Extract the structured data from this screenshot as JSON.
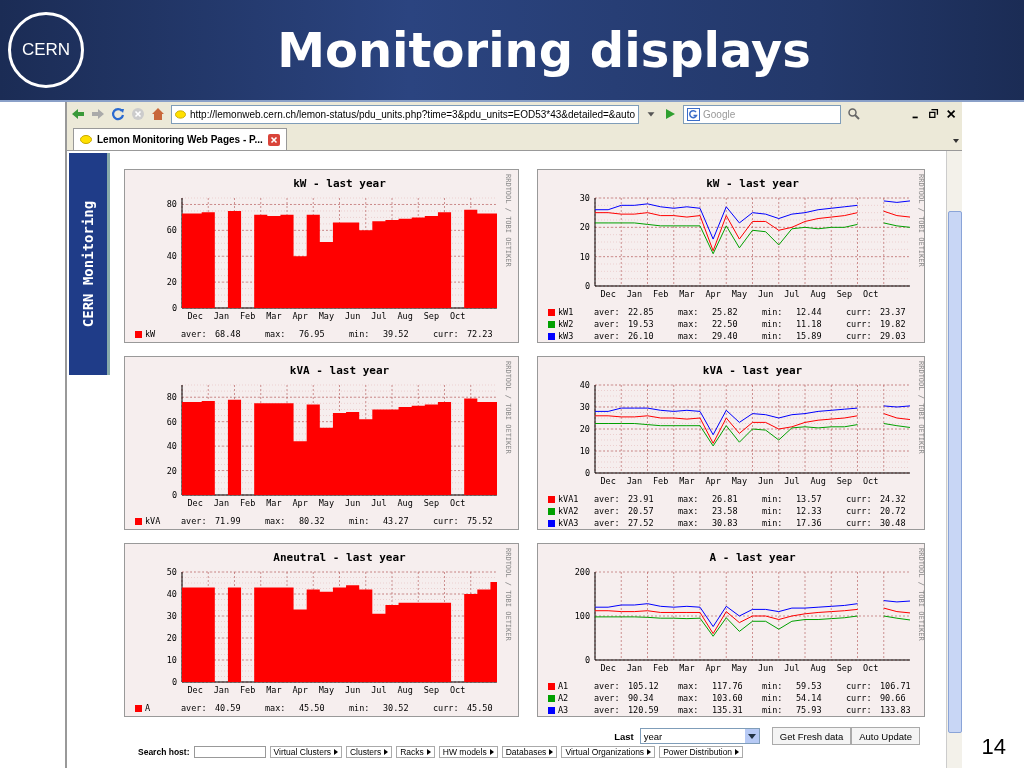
{
  "slide": {
    "logo": "CERN",
    "title": "Monitoring displays",
    "page_number": "14"
  },
  "browser": {
    "url": "http://lemonweb.cern.ch/lemon-status/pdu_units.php?time=3&pdu_units=EOD53*43&detailed=&auto",
    "search_placeholder": "Google",
    "tabs": [
      {
        "label": "Lemon Monitoring Web Pages - P...",
        "selected": true
      }
    ]
  },
  "sidebar_tab": {
    "label": "CERN Monitoring"
  },
  "charts": [
    {
      "credit": "RRDTOOL / TOBI OETIKER",
      "legend": [
        {
          "stats": [
            {
              "label": "aver:",
              "value": "68.48"
            },
            {
              "label": "max:",
              "value": "76.95"
            },
            {
              "label": "min:",
              "value": "39.52"
            },
            {
              "label": "curr:",
              "value": "72.23"
            }
          ]
        }
      ],
      "chart_data": {
        "grid": true,
        "type": "area",
        "title": "kW - last year",
        "categories": [
          null,
          "Dec",
          null,
          "Jan",
          null,
          "Feb",
          null,
          "Mar",
          null,
          "Apr",
          null,
          "May",
          null,
          "Jun",
          null,
          "Jul",
          null,
          "Aug",
          null,
          "Sep",
          null,
          "Oct",
          null,
          null,
          null
        ],
        "ylim": [
          0,
          85
        ],
        "yticks": [
          0,
          20,
          40,
          60,
          80
        ],
        "series": [
          {
            "name": "kW",
            "color": "#ff0000",
            "values": [
              73,
              73,
              74,
              null,
              75,
              null,
              72,
              71,
              72,
              40,
              72,
              51,
              66,
              66,
              60,
              67,
              68,
              69,
              70,
              71,
              74,
              null,
              76,
              73,
              73
            ]
          }
        ]
      }
    },
    {
      "credit": "RRDTOOL / TOBI OETIKER",
      "legend": [
        {
          "stats": [
            {
              "label": "aver:",
              "value": "22.85"
            },
            {
              "label": "max:",
              "value": "25.82"
            },
            {
              "label": "min:",
              "value": "12.44"
            },
            {
              "label": "curr:",
              "value": "23.37"
            }
          ]
        },
        {
          "stats": [
            {
              "label": "aver:",
              "value": "19.53"
            },
            {
              "label": "max:",
              "value": "22.50"
            },
            {
              "label": "min:",
              "value": "11.18"
            },
            {
              "label": "curr:",
              "value": "19.82"
            }
          ]
        },
        {
          "stats": [
            {
              "label": "aver:",
              "value": "26.10"
            },
            {
              "label": "max:",
              "value": "29.40"
            },
            {
              "label": "min:",
              "value": "15.89"
            },
            {
              "label": "curr:",
              "value": "29.03"
            }
          ]
        }
      ],
      "chart_data": {
        "grid": true,
        "type": "line",
        "title": "kW - last year",
        "categories": [
          null,
          "Dec",
          null,
          "Jan",
          null,
          "Feb",
          null,
          "Mar",
          null,
          "Apr",
          null,
          "May",
          null,
          "Jun",
          null,
          "Jul",
          null,
          "Aug",
          null,
          "Sep",
          null,
          "Oct",
          null,
          null,
          null
        ],
        "ylim": [
          0,
          30
        ],
        "yticks": [
          0,
          10,
          20,
          30
        ],
        "series": [
          {
            "name": "kW1",
            "color": "#ff0000",
            "values": [
              25,
              25,
              24.5,
              24.5,
              25,
              24,
              24,
              23.5,
              24,
              12,
              24,
              16,
              22,
              22,
              19,
              20,
              22,
              23,
              23.5,
              24,
              25,
              null,
              25.5,
              24,
              23.5
            ]
          },
          {
            "name": "kW2",
            "color": "#00a000",
            "values": [
              21.5,
              21.5,
              21.5,
              21.5,
              21,
              20.5,
              20.5,
              20.5,
              20.5,
              11,
              20.5,
              13,
              19,
              18.5,
              14,
              19.5,
              20,
              19.5,
              20,
              20,
              21,
              null,
              21.5,
              20.5,
              20
            ]
          },
          {
            "name": "kW3",
            "color": "#0000ff",
            "values": [
              26,
              26,
              27.5,
              27.5,
              28,
              27,
              26.5,
              27,
              26.5,
              16,
              27,
              21.5,
              25,
              24.5,
              23,
              24.5,
              25,
              26,
              26.5,
              27,
              27.5,
              null,
              29,
              28.5,
              29
            ]
          }
        ]
      }
    },
    {
      "credit": "RRDTOOL / TOBI OETIKER",
      "legend": [
        {
          "stats": [
            {
              "label": "aver:",
              "value": "71.99"
            },
            {
              "label": "max:",
              "value": "80.32"
            },
            {
              "label": "min:",
              "value": "43.27"
            },
            {
              "label": "curr:",
              "value": "75.52"
            }
          ]
        }
      ],
      "chart_data": {
        "grid": true,
        "type": "area",
        "title": "kVA - last year",
        "categories": [
          null,
          "Dec",
          null,
          "Jan",
          null,
          "Feb",
          null,
          "Mar",
          null,
          "Apr",
          null,
          "May",
          null,
          "Jun",
          null,
          "Jul",
          null,
          "Aug",
          null,
          "Sep",
          null,
          "Oct",
          null,
          null,
          null
        ],
        "ylim": [
          0,
          90
        ],
        "yticks": [
          0,
          20,
          40,
          60,
          80
        ],
        "series": [
          {
            "name": "kVA",
            "color": "#ff0000",
            "values": [
              76,
              76,
              77,
              null,
              78,
              null,
              75,
              75,
              75,
              44,
              74,
              55,
              67,
              68,
              62,
              70,
              70,
              72,
              73,
              74,
              76,
              null,
              79,
              76,
              76
            ]
          }
        ]
      }
    },
    {
      "credit": "RRDTOOL / TOBI OETIKER",
      "legend": [
        {
          "stats": [
            {
              "label": "aver:",
              "value": "23.91"
            },
            {
              "label": "max:",
              "value": "26.81"
            },
            {
              "label": "min:",
              "value": "13.57"
            },
            {
              "label": "curr:",
              "value": "24.32"
            }
          ]
        },
        {
          "stats": [
            {
              "label": "aver:",
              "value": "20.57"
            },
            {
              "label": "max:",
              "value": "23.58"
            },
            {
              "label": "min:",
              "value": "12.33"
            },
            {
              "label": "curr:",
              "value": "20.72"
            }
          ]
        },
        {
          "stats": [
            {
              "label": "aver:",
              "value": "27.52"
            },
            {
              "label": "max:",
              "value": "30.83"
            },
            {
              "label": "min:",
              "value": "17.36"
            },
            {
              "label": "curr:",
              "value": "30.48"
            }
          ]
        }
      ],
      "chart_data": {
        "grid": true,
        "type": "line",
        "title": "kVA - last year",
        "categories": [
          null,
          "Dec",
          null,
          "Jan",
          null,
          "Feb",
          null,
          "Mar",
          null,
          "Apr",
          null,
          "May",
          null,
          "Jun",
          null,
          "Jul",
          null,
          "Aug",
          null,
          "Sep",
          null,
          "Oct",
          null,
          null,
          null
        ],
        "ylim": [
          0,
          40
        ],
        "yticks": [
          0,
          10,
          20,
          30,
          40
        ],
        "series": [
          {
            "name": "kVA1",
            "color": "#ff0000",
            "values": [
              26,
              26,
              25.5,
              25.5,
              26,
              25,
              25,
              24.5,
              25,
              13.5,
              25,
              18,
              23,
              23,
              20,
              21,
              23,
              24,
              24.5,
              25,
              26,
              null,
              27,
              25,
              24.3
            ]
          },
          {
            "name": "kVA2",
            "color": "#00a000",
            "values": [
              22.5,
              22.5,
              22.5,
              22.5,
              22,
              21.5,
              21.5,
              21.5,
              21.5,
              12.3,
              21.5,
              14,
              20,
              19.5,
              15,
              20.5,
              21,
              20.5,
              21,
              21,
              22,
              null,
              22.5,
              21.5,
              20.7
            ]
          },
          {
            "name": "kVA3",
            "color": "#0000ff",
            "values": [
              28,
              28,
              29.5,
              29.5,
              29.5,
              28.5,
              28,
              28.5,
              28,
              17.4,
              28.5,
              23,
              27,
              26.5,
              25,
              26.5,
              27,
              28,
              28.5,
              29,
              29.5,
              null,
              30.5,
              30,
              30.5
            ]
          }
        ]
      }
    },
    {
      "credit": "RRDTOOL / TOBI OETIKER",
      "legend": [
        {
          "stats": [
            {
              "label": "aver:",
              "value": "40.59"
            },
            {
              "label": "max:",
              "value": "45.50"
            },
            {
              "label": "min:",
              "value": "30.52"
            },
            {
              "label": "curr:",
              "value": "45.50"
            }
          ]
        }
      ],
      "chart_data": {
        "grid": true,
        "type": "area",
        "title": "Aneutral - last year",
        "categories": [
          null,
          "Dec",
          null,
          "Jan",
          null,
          "Feb",
          null,
          "Mar",
          null,
          "Apr",
          null,
          "May",
          null,
          "Jun",
          null,
          "Jul",
          null,
          "Aug",
          null,
          "Sep",
          null,
          "Oct",
          null,
          null,
          null
        ],
        "ylim": [
          0,
          50
        ],
        "yticks": [
          0,
          10,
          20,
          30,
          40,
          50
        ],
        "series": [
          {
            "name": "A",
            "color": "#ff0000",
            "values": [
              43,
              43,
              43,
              null,
              43,
              null,
              43,
              43,
              43,
              33,
              42,
              41,
              43,
              44,
              42,
              31,
              35,
              36,
              36,
              36,
              36,
              null,
              40,
              42,
              45.5
            ]
          }
        ]
      }
    },
    {
      "credit": "RRDTOOL / TOBI OETIKER",
      "legend": [
        {
          "stats": [
            {
              "label": "aver:",
              "value": "105.12"
            },
            {
              "label": "max:",
              "value": "117.76"
            },
            {
              "label": "min:",
              "value": "59.53"
            },
            {
              "label": "curr:",
              "value": "106.71"
            }
          ]
        },
        {
          "stats": [
            {
              "label": "aver:",
              "value": "90.34"
            },
            {
              "label": "max:",
              "value": "103.60"
            },
            {
              "label": "min:",
              "value": "54.14"
            },
            {
              "label": "curr:",
              "value": "90.66"
            }
          ]
        },
        {
          "stats": [
            {
              "label": "aver:",
              "value": "120.59"
            },
            {
              "label": "max:",
              "value": "135.31"
            },
            {
              "label": "min:",
              "value": "75.93"
            },
            {
              "label": "curr:",
              "value": "133.83"
            }
          ]
        }
      ],
      "chart_data": {
        "grid": true,
        "type": "line",
        "title": "A - last year",
        "categories": [
          null,
          "Dec",
          null,
          "Jan",
          null,
          "Feb",
          null,
          "Mar",
          null,
          "Apr",
          null,
          "May",
          null,
          "Jun",
          null,
          "Jul",
          null,
          "Aug",
          null,
          "Sep",
          null,
          "Oct",
          null,
          null,
          null
        ],
        "ylim": [
          0,
          200
        ],
        "yticks": [
          0,
          100,
          200
        ],
        "series": [
          {
            "name": "A1",
            "color": "#ff0000",
            "values": [
              112,
              112,
              110,
              110,
              112,
              108,
              108,
              108,
              108,
              60,
              110,
              85,
              100,
              100,
              92,
              100,
              105,
              108,
              110,
              112,
              115,
              null,
              118,
              110,
              107
            ]
          },
          {
            "name": "A2",
            "color": "#00a000",
            "values": [
              98,
              98,
              98,
              98,
              97,
              95,
              95,
              94,
              95,
              54,
              96,
              65,
              88,
              88,
              70,
              88,
              92,
              92,
              94,
              96,
              100,
              null,
              100,
              95,
              91
            ]
          },
          {
            "name": "A3",
            "color": "#0000ff",
            "values": [
              120,
              120,
              125,
              125,
              128,
              122,
              120,
              122,
              120,
              76,
              122,
              100,
              115,
              115,
              110,
              118,
              118,
              120,
              122,
              124,
              128,
              null,
              135,
              132,
              134
            ]
          }
        ]
      }
    }
  ],
  "controls": {
    "last_label": "Last",
    "period": "year",
    "buttons": [
      "Get Fresh data",
      "Auto Update"
    ]
  },
  "search": {
    "label": "Search host:"
  },
  "menu": [
    "Virtual Clusters",
    "Clusters",
    "Racks",
    "HW models",
    "Databases",
    "Virtual Organizations",
    "Power Distribution"
  ]
}
